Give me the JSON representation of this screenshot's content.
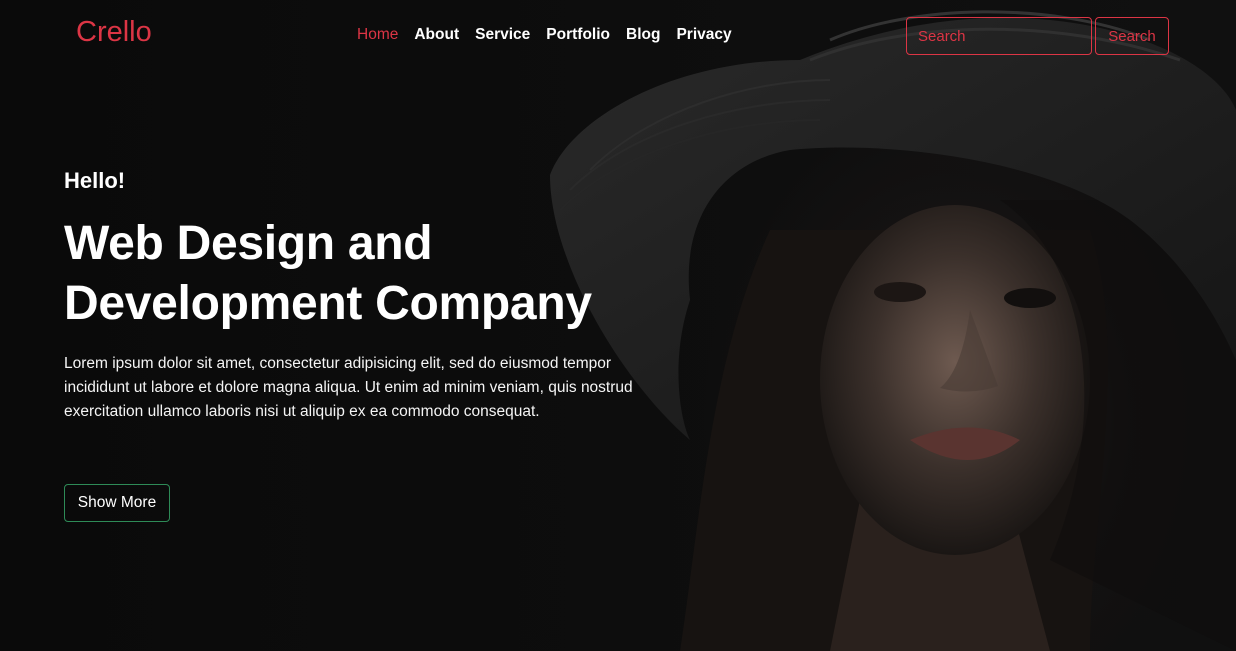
{
  "brand": {
    "name": "Crello",
    "color": "#dc3545"
  },
  "nav": {
    "items": [
      {
        "label": "Home",
        "active": true
      },
      {
        "label": "About",
        "active": false
      },
      {
        "label": "Service",
        "active": false
      },
      {
        "label": "Portfolio",
        "active": false
      },
      {
        "label": "Blog",
        "active": false
      },
      {
        "label": "Privacy",
        "active": false
      }
    ]
  },
  "search": {
    "placeholder": "Search",
    "value": "",
    "button_label": "Search"
  },
  "hero": {
    "greeting": "Hello!",
    "headline_line1": "Web Design and",
    "headline_line2": "Development Company",
    "description": "Lorem ipsum dolor sit amet, consectetur adipisicing elit, sed do eiusmod tempor incididunt ut labore et dolore magna aliqua. Ut enim ad minim veniam, quis nostrud exercitation ullamco laboris nisi ut aliquip ex ea commodo consequat.",
    "cta_label": "Show More"
  },
  "colors": {
    "accent": "#dc3545",
    "cta_border": "#2e8b57",
    "background": "#0b0b0b"
  }
}
